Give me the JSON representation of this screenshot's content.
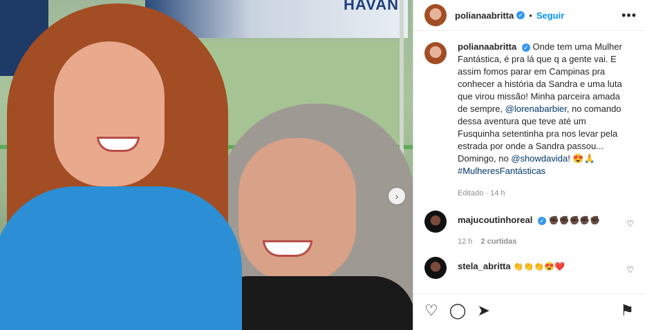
{
  "post": {
    "username": "polianaabritta",
    "verified_mark": "✓",
    "dot": "•",
    "follow_label": "Seguir",
    "more_label": "•••"
  },
  "caption": {
    "username": "polianaabritta",
    "text_1": "Onde tem uma Mulher Fantástica, é pra lá que q a gente vai. E assim fomos parar em Campinas pra conhecer a história da Sandra e uma luta que virou missão! Minha parceira amada de sempre, ",
    "mention_1": "@lorenabarbier",
    "text_2": ", no comando dessa aventura que teve até um Fusquinha setentinha pra nos levar pela estrada por onde a Sandra passou... Domingo, no ",
    "mention_2": "@showdavida",
    "text_3": "! 😍🙏",
    "hashtag": "#MulheresFantásticas",
    "edited": "Editado",
    "time": "14 h"
  },
  "comments": [
    {
      "username": "majucoutinhoreal",
      "verified_mark": "✓",
      "text": "✊🏿✊🏿✊🏿✊🏿✊🏿",
      "time": "12 h",
      "likes": "2 curtidas"
    },
    {
      "username": "stela_abritta",
      "text": "👏👏👏😍❤️"
    }
  ],
  "photo": {
    "banner_text": "HAVAN"
  },
  "icons": {
    "next": "›",
    "like": "♡",
    "comment": "◯",
    "share": "➤",
    "save": "⚑",
    "heart_small": "♡"
  }
}
